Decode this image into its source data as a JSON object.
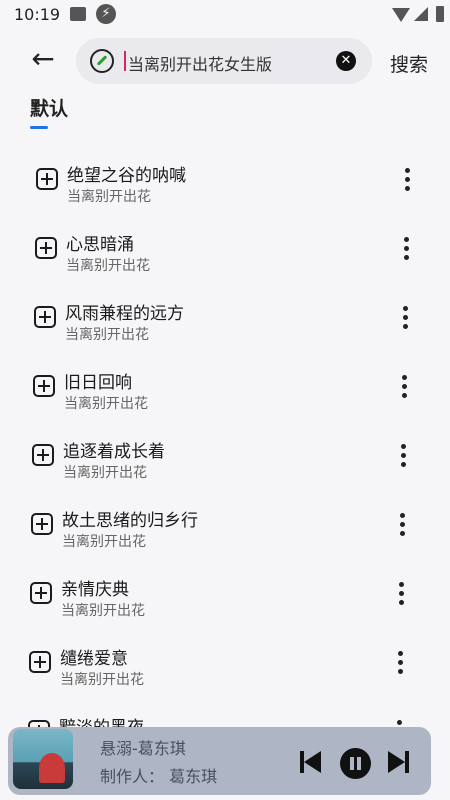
{
  "status_bar": {
    "time": "10:19"
  },
  "search": {
    "query": "当离别开出花女生版",
    "submit_label": "搜索"
  },
  "tabs": [
    {
      "label": "默认",
      "active": true
    }
  ],
  "songs": [
    {
      "title": "绝望之谷的呐喊",
      "artist": "当离别开出花"
    },
    {
      "title": "心思暗涌",
      "artist": "当离别开出花"
    },
    {
      "title": "风雨兼程的远方",
      "artist": "当离别开出花"
    },
    {
      "title": "旧日回响",
      "artist": "当离别开出花"
    },
    {
      "title": "追逐着成长着",
      "artist": "当离别开出花"
    },
    {
      "title": "故土思绪的归乡行",
      "artist": "当离别开出花"
    },
    {
      "title": "亲情庆典",
      "artist": "当离别开出花"
    },
    {
      "title": "缱绻爱意",
      "artist": "当离别开出花"
    },
    {
      "title": "黯淡的黑夜",
      "artist": ""
    }
  ],
  "player": {
    "title": "悬溺-葛东琪",
    "maker": "制作人：  葛东琪"
  },
  "colors": {
    "accent": "#1e73e8",
    "player_bg": "#aeb5c4",
    "background": "#f6f6f8"
  }
}
